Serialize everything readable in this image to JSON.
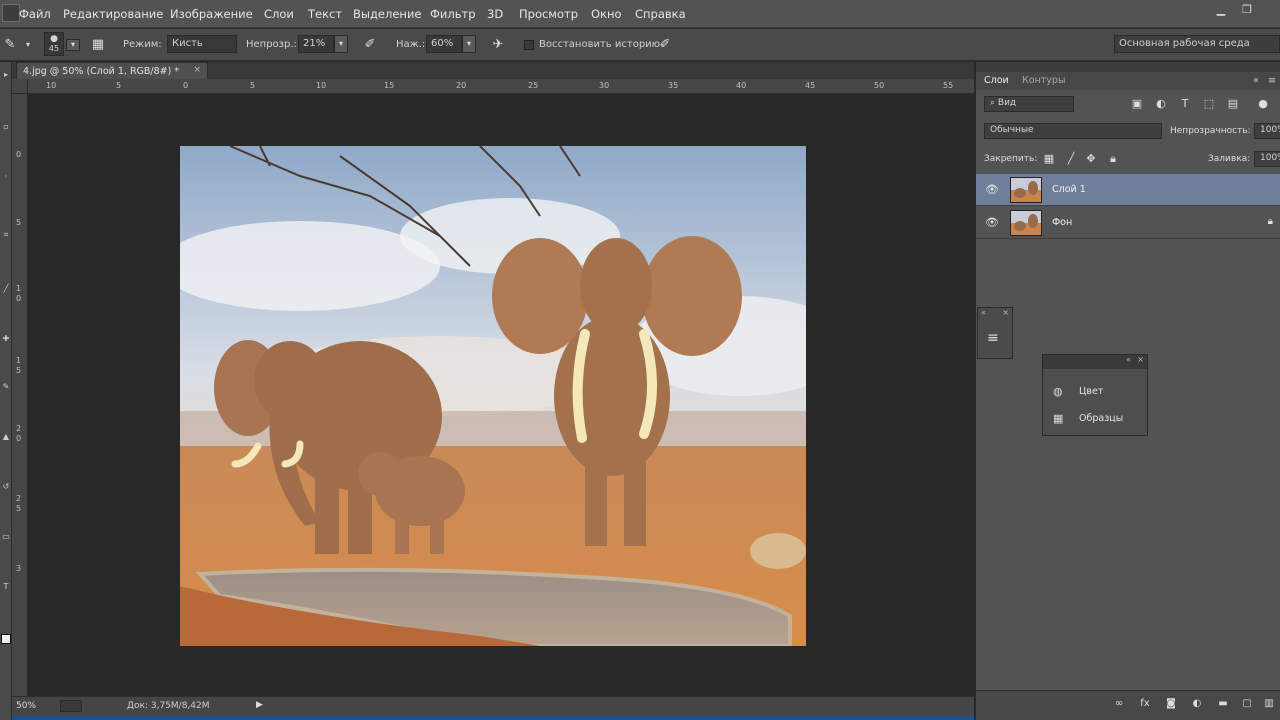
{
  "menu": {
    "items": [
      "Файл",
      "Редактирование",
      "Изображение",
      "Слои",
      "Текст",
      "Выделение",
      "Фильтр",
      "3D",
      "Просмотр",
      "Окно",
      "Справка"
    ]
  },
  "options_bar": {
    "brush_size": "45",
    "mode_label": "Режим:",
    "mode_value": "Кисть",
    "opacity_label": "Непрозр.:",
    "opacity_value": "21%",
    "pressure_label": "Наж.:",
    "pressure_value": "60%",
    "restore_history_label": "Восстановить историю",
    "workspace": "Основная рабочая среда"
  },
  "document": {
    "tab_title": "4.jpg @ 50% (Слой 1, RGB/8#) *",
    "zoom": "50%",
    "doc_info": "Док: 3,75М/8,42М"
  },
  "ruler": {
    "horizontal_ticks": [
      "10",
      "5",
      "0",
      "5",
      "10",
      "15",
      "20",
      "25",
      "30",
      "35",
      "40",
      "45",
      "50",
      "55"
    ],
    "vertical_ticks": [
      "0",
      "5",
      "1",
      "0",
      "1",
      "5",
      "2",
      "0",
      "2",
      "5",
      "3"
    ]
  },
  "layers_panel": {
    "tabs": [
      "Слои",
      "Контуры"
    ],
    "filter_kind": "Вид",
    "blend_mode": "Обычные",
    "opacity_label": "Непрозрачность:",
    "opacity_value": "100%",
    "lock_label": "Закрепить:",
    "fill_label": "Заливка:",
    "fill_value": "100%",
    "layers": [
      {
        "name": "Слой 1",
        "selected": true
      },
      {
        "name": "Фон",
        "selected": false,
        "locked": true
      }
    ]
  },
  "float_panel": {
    "items": [
      {
        "icon": "color-icon",
        "label": "Цвет"
      },
      {
        "icon": "swatches-icon",
        "label": "Образцы"
      }
    ]
  }
}
